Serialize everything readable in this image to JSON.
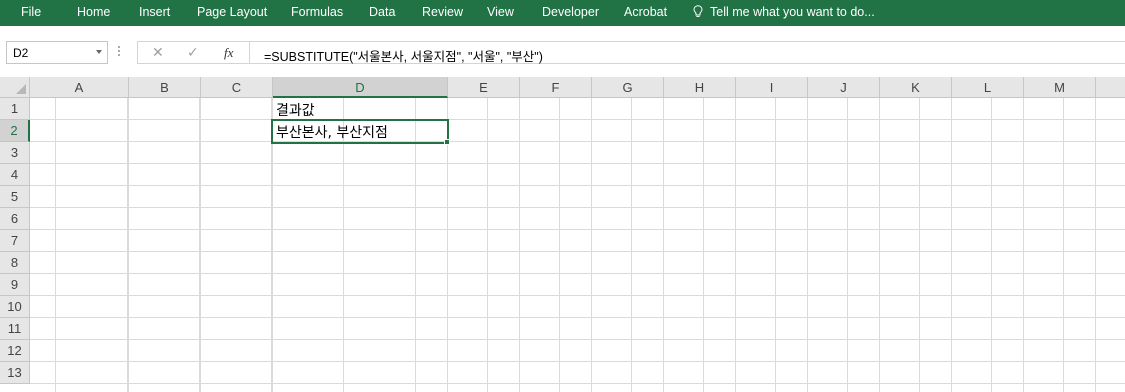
{
  "ribbon": {
    "tabs": [
      "File",
      "Home",
      "Insert",
      "Page Layout",
      "Formulas",
      "Data",
      "Review",
      "View",
      "Developer",
      "Acrobat"
    ],
    "tell_me": "Tell me what you want to do..."
  },
  "formula_bar": {
    "name_box": "D2",
    "cancel_symbol": "✕",
    "enter_symbol": "✓",
    "fx_label": "fx",
    "formula": "=SUBSTITUTE(\"서울본사, 서울지점\", \"서울\", \"부산\")"
  },
  "sheet": {
    "columns": [
      "A",
      "B",
      "C",
      "D",
      "E",
      "F",
      "G",
      "H",
      "I",
      "J",
      "K",
      "L",
      "M"
    ],
    "rows": [
      "1",
      "2",
      "3",
      "4",
      "5",
      "6",
      "7",
      "8",
      "9",
      "10",
      "11",
      "12",
      "13"
    ],
    "active_cell": "D2",
    "cells": {
      "D1": "결과값",
      "D2": "부산본사, 부산지점"
    }
  },
  "colors": {
    "ribbon": "#217346",
    "accent": "#217346",
    "header_bg": "#e6e6e6",
    "gridline": "#dadada"
  }
}
